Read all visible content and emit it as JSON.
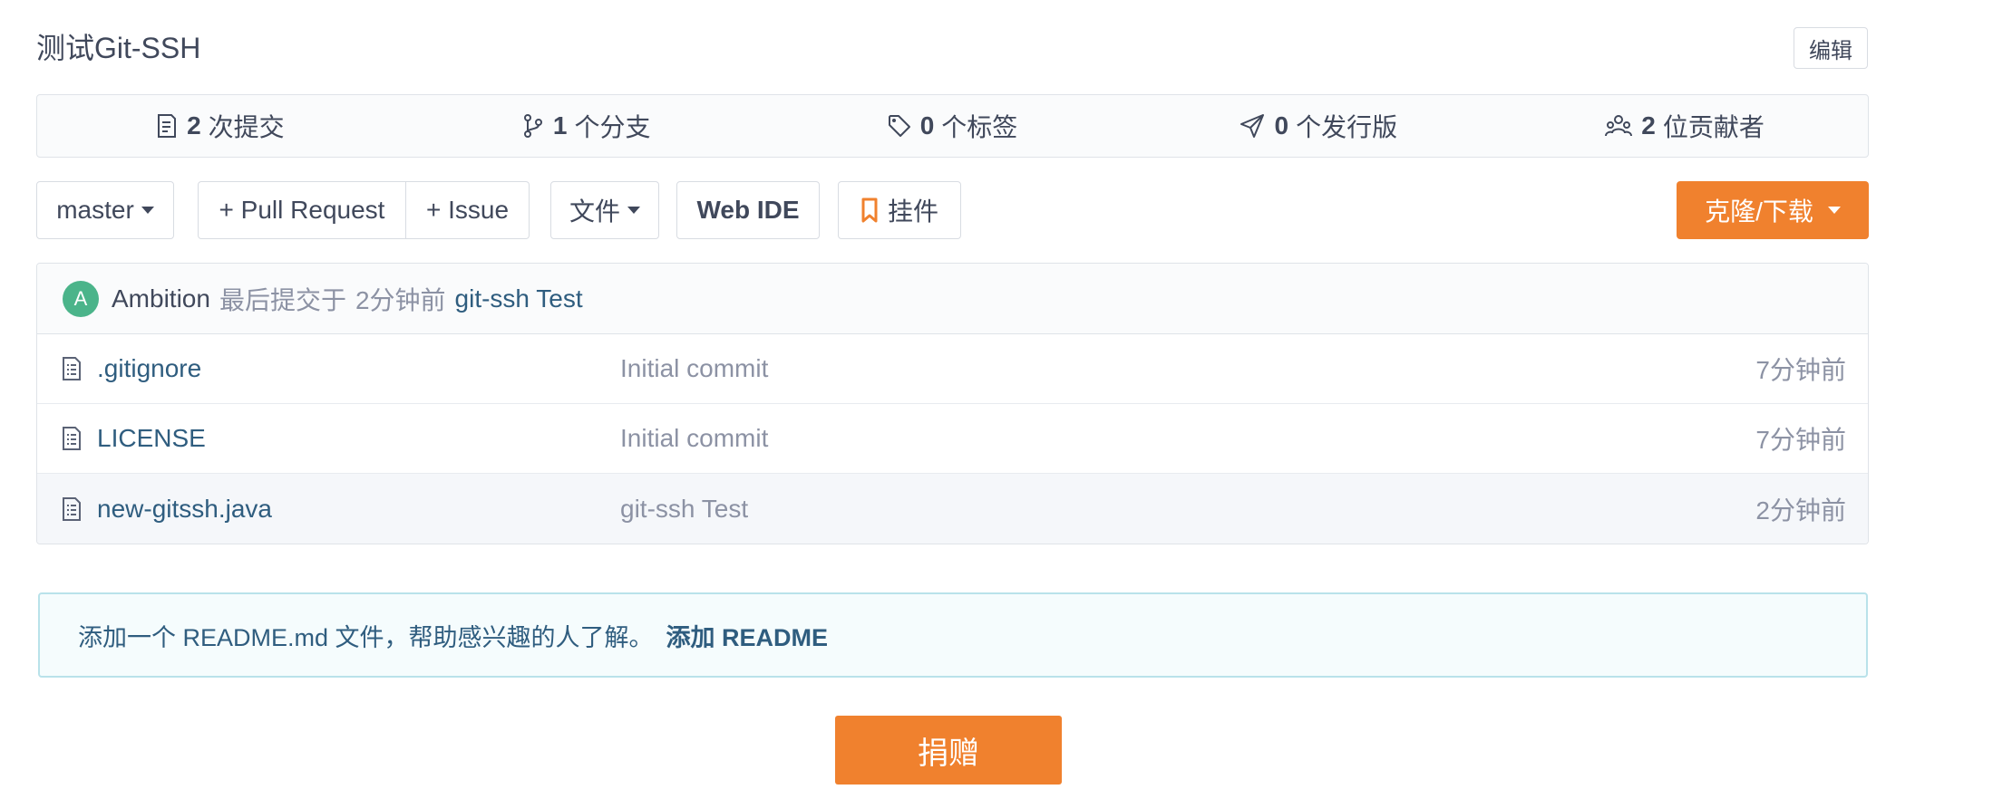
{
  "repo": {
    "title": "测试Git-SSH",
    "edit_label": "编辑"
  },
  "stats": [
    {
      "num": "2",
      "label": "次提交",
      "icon": "commit-icon"
    },
    {
      "num": "1",
      "label": "个分支",
      "icon": "branch-icon"
    },
    {
      "num": "0",
      "label": "个标签",
      "icon": "tag-icon"
    },
    {
      "num": "0",
      "label": "个发行版",
      "icon": "release-icon"
    },
    {
      "num": "2",
      "label": "位贡献者",
      "icon": "contributors-icon"
    }
  ],
  "toolbar": {
    "branch": "master",
    "pull_request": "+ Pull Request",
    "issue": "+ Issue",
    "files": "文件",
    "web_ide": "Web IDE",
    "widget": "挂件",
    "clone": "克隆/下载"
  },
  "last_commit": {
    "avatar_letter": "A",
    "author": "Ambition",
    "prefix": "最后提交于",
    "time": "2分钟前",
    "message": "git-ssh Test"
  },
  "files": [
    {
      "name": ".gitignore",
      "commit": "Initial commit",
      "time": "7分钟前"
    },
    {
      "name": "LICENSE",
      "commit": "Initial commit",
      "time": "7分钟前"
    },
    {
      "name": "new-gitssh.java",
      "commit": "git-ssh Test",
      "time": "2分钟前"
    }
  ],
  "readme": {
    "text": "添加一个 README.md 文件，帮助感兴趣的人了解。",
    "link": "添加 README"
  },
  "donate": "捐赠",
  "colors": {
    "accent": "#f0812e",
    "link": "#2f5d7f",
    "avatar": "#4bb48a"
  }
}
